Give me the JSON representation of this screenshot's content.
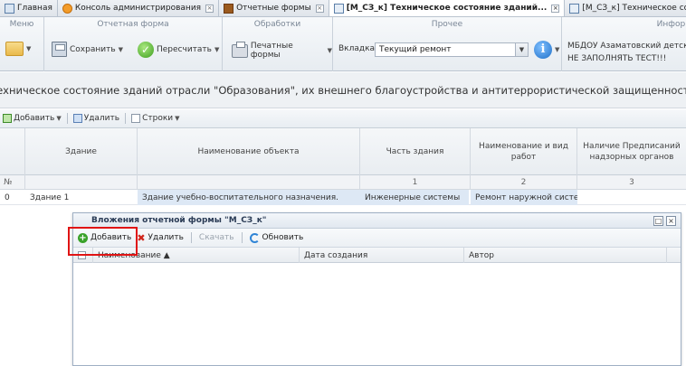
{
  "tabs": [
    {
      "label": "Главная",
      "icon": "home-icon",
      "closable": false,
      "active": false
    },
    {
      "label": "Консоль администрирования",
      "icon": "console-icon",
      "closable": true,
      "active": false
    },
    {
      "label": "Отчетные формы",
      "icon": "forms-icon",
      "closable": true,
      "active": false
    },
    {
      "label": "[М_СЗ_к] Техническое состояние зданий...",
      "icon": "report-icon",
      "closable": true,
      "active": true
    },
    {
      "label": "[М_СЗ_к] Техническое состояние",
      "icon": "report-icon",
      "closable": false,
      "active": false
    }
  ],
  "ribbon": {
    "menu_title": "Меню",
    "form_title": "Отчетная форма",
    "save_label": "Сохранить",
    "recalc_label": "Пересчитать",
    "processing_title": "Обработки",
    "print_label": "Печатные формы",
    "other_title": "Прочее",
    "tab_select_label": "Вкладка",
    "tab_select_value": "Текущий ремонт",
    "info_title": "Информ",
    "org_line1": "МБДОУ Азаматовский детский",
    "org_line2": "НЕ ЗАПОЛНЯТЬ ТЕСТ!!!"
  },
  "report_title": "Техническое состояние зданий отрасли \"Образования\", их внешнего благоустройства и антитеррористической защищенности",
  "rowtools": {
    "add_label": "Добавить",
    "delete_label": "Удалить",
    "rows_label": "Строки"
  },
  "grid": {
    "headers": [
      "Здание",
      "Наименование объекта",
      "Часть здания",
      "Наименование и вид работ",
      "Наличие Предписаний надзорных органов"
    ],
    "numbers": [
      "№",
      "1",
      "2",
      "3"
    ],
    "row": {
      "index": "0",
      "building": "Здание 1",
      "object": "Здание учебно-воспитательного назначения.",
      "part": "Инженерные системы",
      "work": "Ремонт наружной систе..."
    }
  },
  "popup": {
    "title": "Вложения отчетной формы \"М_СЗ_к\"",
    "add_label": "Добавить",
    "delete_label": "Удалить",
    "download_label": "Скачать",
    "refresh_label": "Обновить",
    "columns": [
      "Наименование ▲",
      "Дата создания",
      "Автор"
    ]
  }
}
